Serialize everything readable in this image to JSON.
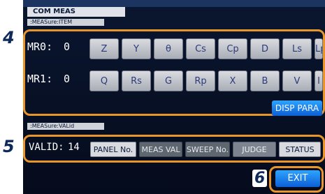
{
  "screen": {
    "title": "COM MEAS"
  },
  "sections": {
    "meas_item": ":MEASure:ITEM",
    "meas_val": ":MEASure:VALid"
  },
  "callouts": [
    "4",
    "5",
    "6"
  ],
  "mr0": {
    "label": "MR0:",
    "value": "0",
    "buttons": [
      "Z",
      "Y",
      "θ",
      "Cs",
      "Cp",
      "D",
      "Ls",
      "Lp"
    ]
  },
  "mr1": {
    "label": "MR1:",
    "value": "0",
    "buttons": [
      "Q",
      "Rs",
      "G",
      "Rp",
      "X",
      "B",
      "V",
      "I"
    ]
  },
  "disp_para": "DISP PARA",
  "valid": {
    "label": "VALID:",
    "value": "14",
    "buttons": [
      "PANEL No.",
      "MEAS VAL",
      "SWEEP No.",
      "JUDGE",
      "STATUS"
    ],
    "states": [
      "on",
      "off",
      "off",
      "on",
      "on"
    ]
  },
  "exit": "EXIT",
  "colors": {
    "highlight": "#e8962c",
    "accent_blue": "#0c5fd6",
    "screen_bg": "#050b1c"
  }
}
